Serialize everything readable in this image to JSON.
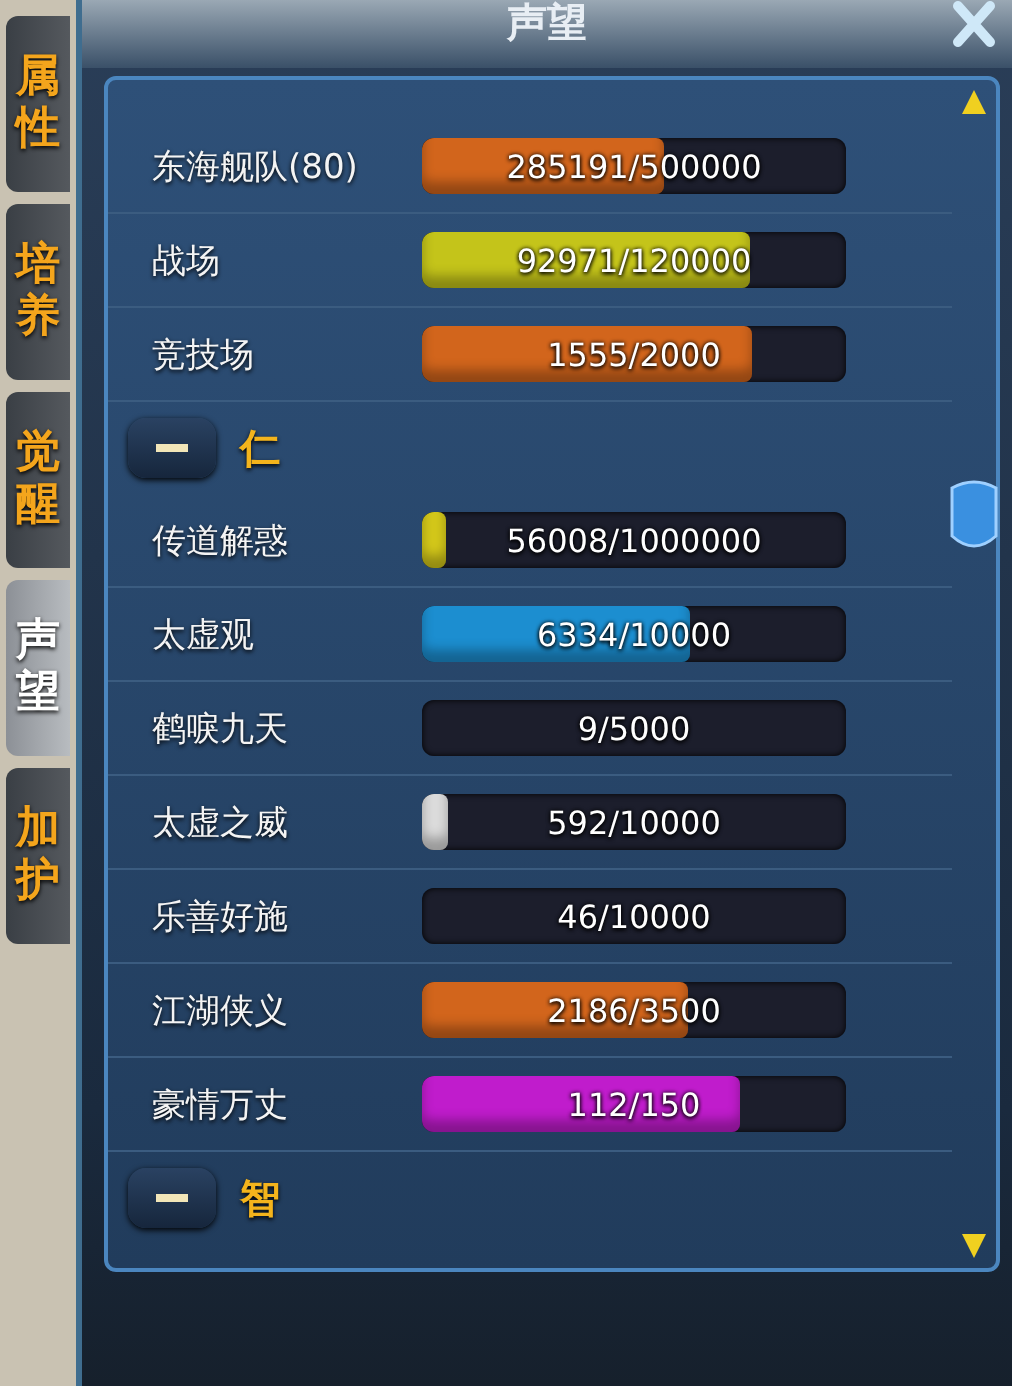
{
  "tabs": [
    {
      "label": "属性",
      "selected": false
    },
    {
      "label": "培养",
      "selected": false
    },
    {
      "label": "觉醒",
      "selected": false
    },
    {
      "label": "声望",
      "selected": true
    },
    {
      "label": "加护",
      "selected": false
    }
  ],
  "window": {
    "title": "声望"
  },
  "entries": [
    {
      "kind": "row",
      "name": "东海舰队(80)",
      "reading": "285191/500000",
      "level": 0.57,
      "color": "#d2651c"
    },
    {
      "kind": "row",
      "name": "战场",
      "reading": "92971/120000",
      "level": 0.775,
      "color": "#c4c41a"
    },
    {
      "kind": "row",
      "name": "竞技场",
      "reading": "1555/2000",
      "level": 0.78,
      "color": "#d2651c"
    },
    {
      "kind": "group",
      "name": "仁",
      "expanded": true
    },
    {
      "kind": "row",
      "name": "传道解惑",
      "reading": "56008/1000000",
      "level": 0.056,
      "color": "#d4c81a"
    },
    {
      "kind": "row",
      "name": "太虚观",
      "reading": "6334/10000",
      "level": 0.63,
      "color": "#1c8ed0"
    },
    {
      "kind": "row",
      "name": "鹤唳九天",
      "reading": "9/5000",
      "level": 0
    },
    {
      "kind": "row",
      "name": "太虚之威",
      "reading": "592/10000",
      "level": 0.059,
      "color": "#dcdcdc"
    },
    {
      "kind": "row",
      "name": "乐善好施",
      "reading": "46/10000",
      "level": 0
    },
    {
      "kind": "row",
      "name": "江湖侠义",
      "reading": "2186/3500",
      "level": 0.625,
      "color": "#d2651c"
    },
    {
      "kind": "row",
      "name": "豪情万丈",
      "reading": "112/150",
      "level": 0.75,
      "color": "#c01ccc"
    },
    {
      "kind": "group",
      "name": "智",
      "expanded": true
    }
  ]
}
